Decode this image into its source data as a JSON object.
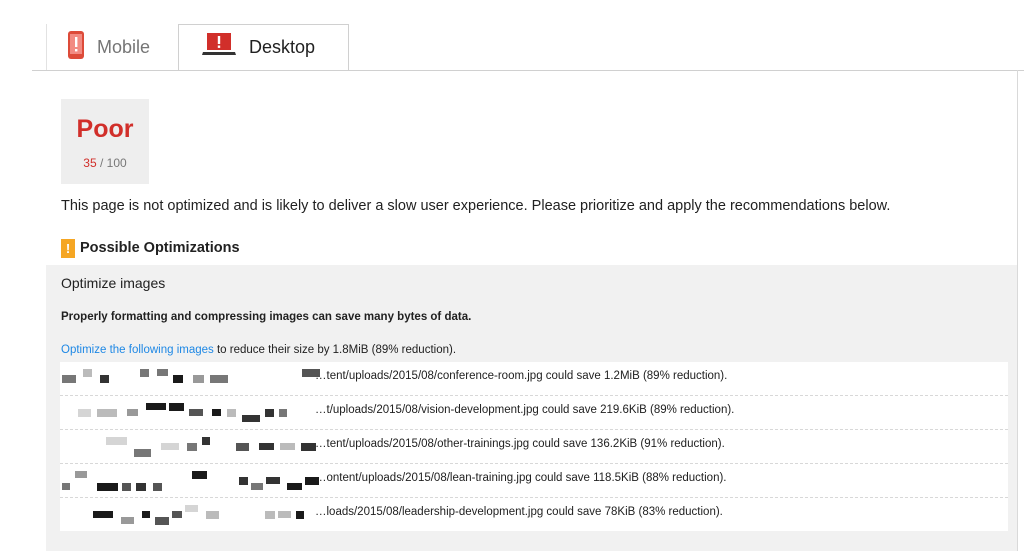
{
  "tabs": {
    "mobile": {
      "label": "Mobile",
      "icon": "phone-warning-icon"
    },
    "desktop": {
      "label": "Desktop",
      "icon": "laptop-warning-icon",
      "active": true
    }
  },
  "score": {
    "label": "Poor",
    "value": "35",
    "max": "/ 100",
    "color": "#d12f2a"
  },
  "summary": "This page is not optimized and is likely to deliver a slow user experience. Please prioritize and apply the recommendations below.",
  "optimizations": {
    "badge": "!",
    "heading": "Possible Optimizations",
    "rule": {
      "title": "Optimize images",
      "description": "Properly formatting and compressing images can save many bytes of data.",
      "summary_link": "Optimize the following images",
      "summary_rest": " to reduce their size by 1.8MiB (89% reduction).",
      "items": [
        {
          "text": "…tent/uploads/2015/08/conference-room.jpg could save 1.2MiB (89% reduction)."
        },
        {
          "text": "…t/uploads/2015/08/vision-development.jpg could save 219.6KiB (89% reduction)."
        },
        {
          "text": "…tent/uploads/2015/08/other-trainings.jpg could save 136.2KiB (91% reduction)."
        },
        {
          "text": "…ontent/uploads/2015/08/lean-training.jpg could save 118.5KiB (88% reduction)."
        },
        {
          "text": "…loads/2015/08/leadership-development.jpg could save 78KiB (83% reduction)."
        }
      ]
    }
  }
}
